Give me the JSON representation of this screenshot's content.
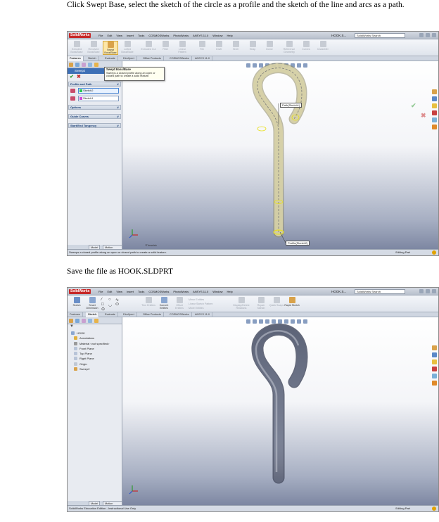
{
  "captions": {
    "step1": "Click Swept Base, select the sketch of the circle as a profile and the sketch of the line and arcs as a path.",
    "step2": "Save the file as HOOK.SLDPRT"
  },
  "app": {
    "logo": "SolidWorks",
    "menu": [
      "File",
      "Edit",
      "View",
      "Insert",
      "Tools",
      "COSMOSWorks",
      "PhotoWorks",
      "ANSYS 11.0",
      "Window",
      "Help"
    ],
    "doc_title": "HOOK.S...",
    "search_placeholder": "SolidWorks Search"
  },
  "screenshot1": {
    "ribbon_buttons": [
      "Extruded Boss/Base",
      "Revolved Boss/Base",
      "Swept Boss/Base",
      "Lofted Boss/Base",
      "Extruded Cut",
      "Fillet",
      "Linear Pattern",
      "Rib",
      "Draft",
      "Shell",
      "Wrap",
      "Dome",
      "Reference Geometry",
      "Curves",
      "Instant3D"
    ],
    "tabs": [
      "Features",
      "Sketch",
      "Evaluate",
      "DimXpert",
      "Office Products",
      "COSMOSWorks",
      "ANSYS 11.0"
    ],
    "tooltip_title": "Swept Boss/Base",
    "tooltip_text": "Sweeps a closed profile along an open or closed path to create a solid feature.",
    "property_title": "Sweep2",
    "sections": [
      "Profile and Path",
      "Options",
      "Guide Curves",
      "Start/End Tangency"
    ],
    "profile_value": "Sketch2",
    "path_value": "Sketch1",
    "path_tag": "Path(Sketch1)",
    "profile_tag": "Profile(Sketch2)",
    "view_label": "*Trimetric",
    "bottom_tabs": [
      "Model",
      "Motion Study 1"
    ],
    "status_text": "Sweeps a closed profile along an open or closed path to create a solid feature.",
    "status_right": "Editing Part"
  },
  "screenshot2": {
    "ribbon_buttons": [
      "Sketch",
      "Smart Dimension",
      "Trim Entities",
      "Convert Entities",
      "Offset Entities",
      "Mirror Entities",
      "Linear Sketch Pattern",
      "Move Entities",
      "Display/Delete Relations",
      "Repair Sketch",
      "Quick Snaps",
      "Rapid Sketch"
    ],
    "tabs": [
      "Features",
      "Sketch",
      "Evaluate",
      "DimXpert",
      "Office Products",
      "COSMOSWorks",
      "ANSYS 11.0"
    ],
    "tree": [
      "HOOK",
      "Annotations",
      "Material <not specified>",
      "Front Plane",
      "Top Plane",
      "Right Plane",
      "Origin",
      "Sweep2"
    ],
    "bottom_tabs": [
      "Model",
      "Motion Study 1"
    ],
    "status_text": "SolidWorks Education Edition - Instructional Use Only",
    "status_right": "Editing Part"
  },
  "colors": {
    "hook_translucent": "#c8c49a",
    "hook_solid": "#8c93a8",
    "edge_highlight": "#e8e020",
    "brand": "#c62828"
  }
}
